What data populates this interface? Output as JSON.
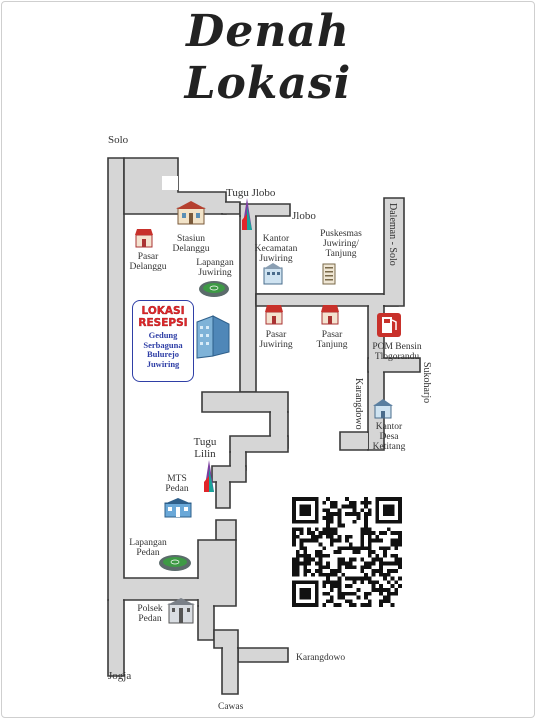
{
  "title": {
    "line1": "Denah",
    "line2": "Lokasi"
  },
  "venue": {
    "heading_1": "LOKASI",
    "heading_2": "RESEPSI",
    "name_1": "Gedung",
    "name_2": "Serbaguna",
    "name_3": "Bulurejo",
    "name_4": "Juwiring"
  },
  "directions": {
    "solo": "Solo",
    "jlobo": "Jlobo",
    "jogja": "Jogja",
    "cawas": "Cawas",
    "karangdowo_south": "Karangdowo",
    "karangdowo_vertical": "Karangdowo",
    "delanggu_solo": "Daleman - Solo",
    "sukoharjo": "Sukoharjo"
  },
  "landmarks": {
    "tugu_jlobo": "Tugu Jlobo",
    "stasiun_1": "Stasiun",
    "stasiun_2": "Delanggu",
    "pasar_delanggu_1": "Pasar",
    "pasar_delanggu_2": "Delanggu",
    "lapangan_juwiring_1": "Lapangan",
    "lapangan_juwiring_2": "Juwiring",
    "kantor_kec_1": "Kantor",
    "kantor_kec_2": "Kecamatan",
    "kantor_kec_3": "Juwiring",
    "puskesmas_1": "Puskesmas",
    "puskesmas_2": "Juwiring/",
    "puskesmas_3": "Tanjung",
    "pasar_juwiring_1": "Pasar",
    "pasar_juwiring_2": "Juwiring",
    "pasar_tanjung_1": "Pasar",
    "pasar_tanjung_2": "Tanjung",
    "pom_1": "POM Bensin",
    "pom_2": "Tlogorandu",
    "kantor_desa_1": "Kantor",
    "kantor_desa_2": "Desa",
    "kantor_desa_3": "Ketitang",
    "tugu_lilin_1": "Tugu",
    "tugu_lilin_2": "Lilin",
    "mts_1": "MTS",
    "mts_2": "Pedan",
    "lapangan_pedan_1": "Lapangan",
    "lapangan_pedan_2": "Pedan",
    "polsek_1": "Polsek",
    "polsek_2": "Pedan"
  },
  "colors": {
    "road_fill": "#d6d6d6",
    "road_edge": "#3a3a3a",
    "venue_red": "#e0262a",
    "venue_blue": "#2f3fa6",
    "market_red": "#c8312b",
    "monument_purple": "#7b3fa0",
    "monument_teal": "#1aa39a"
  },
  "icons": {
    "station": "station-icon",
    "market": "market-awning-icon",
    "stadium": "stadium-icon",
    "office": "office-building-icon",
    "monument": "monument-icon",
    "fuel": "fuel-pump-icon",
    "school": "school-icon",
    "police": "police-station-icon",
    "qr": "qr-code-icon"
  }
}
